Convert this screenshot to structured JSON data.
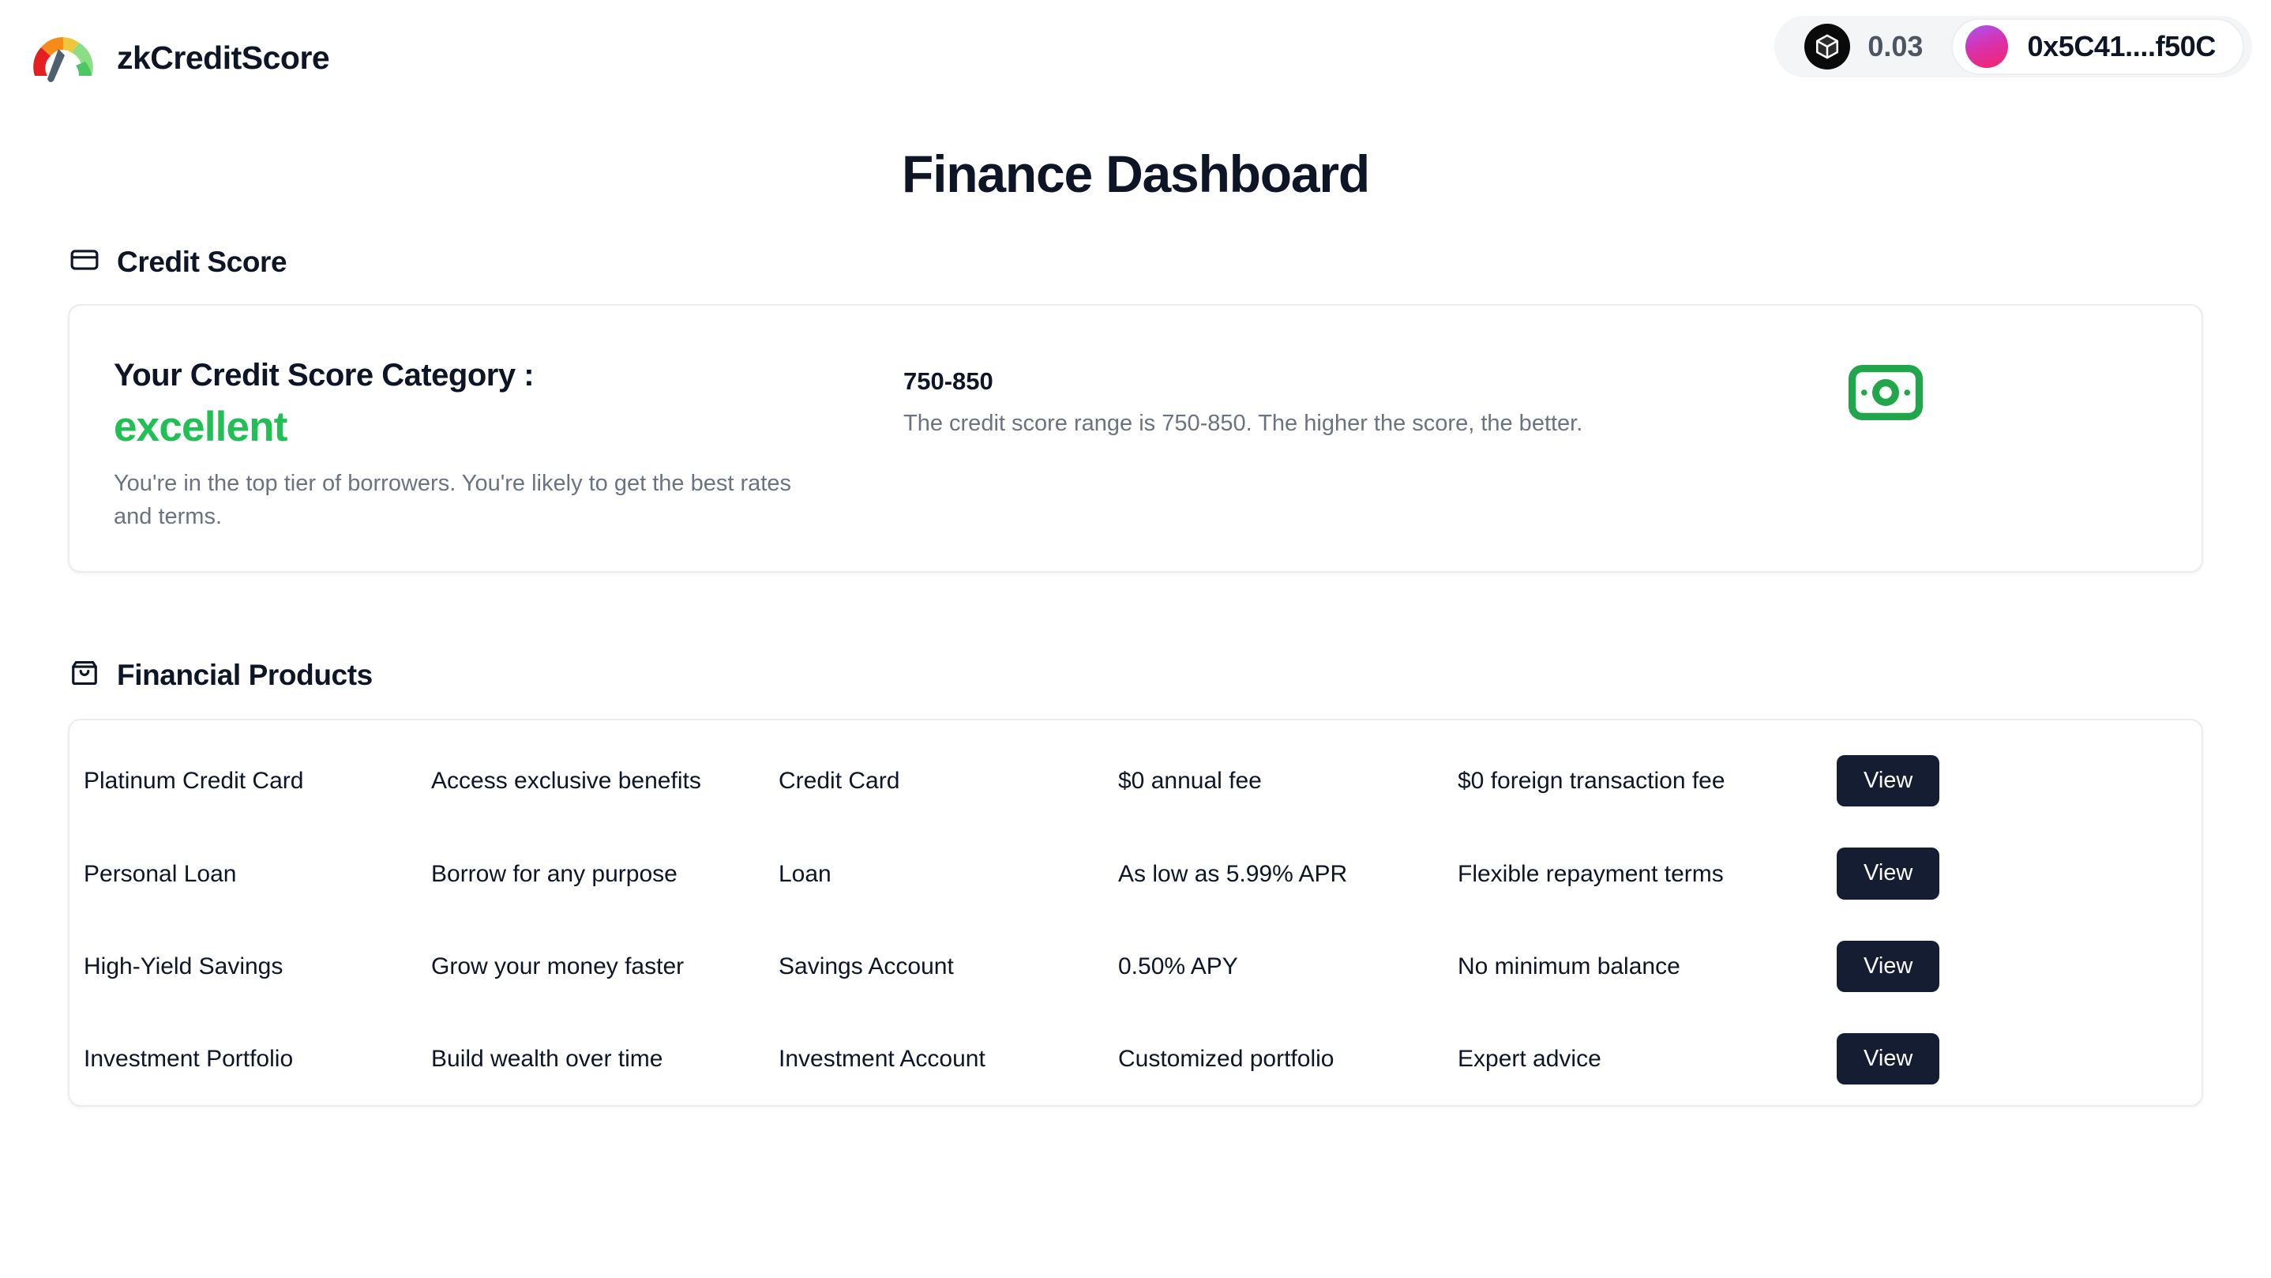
{
  "header": {
    "brand_name": "zkCreditScore",
    "logo_icon": "credit-gauge-logo",
    "balance": {
      "icon": "cube-icon",
      "value": "0.03"
    },
    "wallet": {
      "avatar_icon": "wallet-avatar",
      "address": "0x5C41....f50C"
    }
  },
  "page": {
    "title": "Finance Dashboard"
  },
  "credit_score_section": {
    "icon": "credit-card-icon",
    "title": "Credit Score",
    "category_label": "Your Credit Score Category :",
    "category_value": "excellent",
    "category_color": "#22bf55",
    "category_description": "You're in the top tier of borrowers. You're likely to get the best rates and terms.",
    "range": "750-850",
    "range_description": "The credit score range is 750-850. The higher the score, the better.",
    "range_icon": "banknote-icon"
  },
  "financial_products_section": {
    "icon": "shopping-bag-icon",
    "title": "Financial Products",
    "action_label": "View",
    "rows": [
      {
        "name": "Platinum Credit Card",
        "description": "Access exclusive benefits",
        "type": "Credit Card",
        "rate": "$0 annual fee",
        "detail": "$0 foreign transaction fee"
      },
      {
        "name": "Personal Loan",
        "description": "Borrow for any purpose",
        "type": "Loan",
        "rate": "As low as 5.99% APR",
        "detail": "Flexible repayment terms"
      },
      {
        "name": "High-Yield Savings",
        "description": "Grow your money faster",
        "type": "Savings Account",
        "rate": "0.50% APY",
        "detail": "No minimum balance"
      },
      {
        "name": "Investment Portfolio",
        "description": "Build wealth over time",
        "type": "Investment Account",
        "rate": "Customized portfolio",
        "detail": "Expert advice"
      }
    ]
  },
  "theme": {
    "accent_green": "#22bf55",
    "ink": "#0d1526",
    "muted": "#6b7280",
    "button_bg": "#141d32",
    "card_border": "#eaecef"
  }
}
